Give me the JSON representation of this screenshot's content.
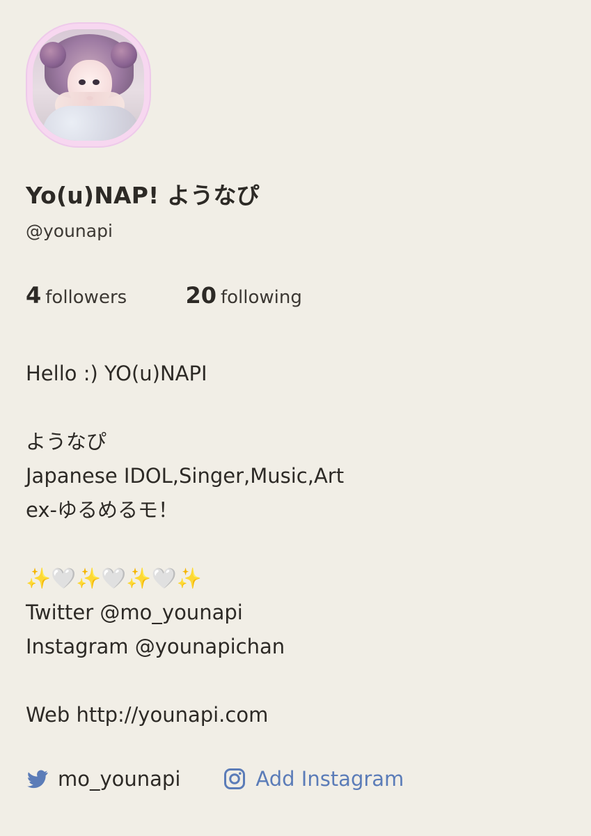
{
  "profile": {
    "name": "Yo(u)NAP! ようなぴ",
    "handle": "@younapi",
    "avatar_alt": "Profile photo",
    "accent_color": "#f7d7f0"
  },
  "stats": {
    "followers": {
      "count": "4",
      "label": "followers"
    },
    "following": {
      "count": "20",
      "label": "following"
    }
  },
  "bio": {
    "text": "Hello :) YO(u)NAPI\n\nようなぴ\nJapanese IDOL,Singer,Music,Art\nex-ゆるめるモ！\n\n✨🤍✨🤍✨🤍✨\nTwitter @mo_younapi\nInstagram @younapichan\n\nWeb http://younapi.com"
  },
  "links": {
    "twitter": {
      "label": "mo_younapi",
      "icon": "twitter-bird-icon",
      "color": "#5b7cb8"
    },
    "instagram": {
      "label": "Add Instagram",
      "icon": "instagram-icon",
      "color": "#5b7cb8"
    }
  }
}
